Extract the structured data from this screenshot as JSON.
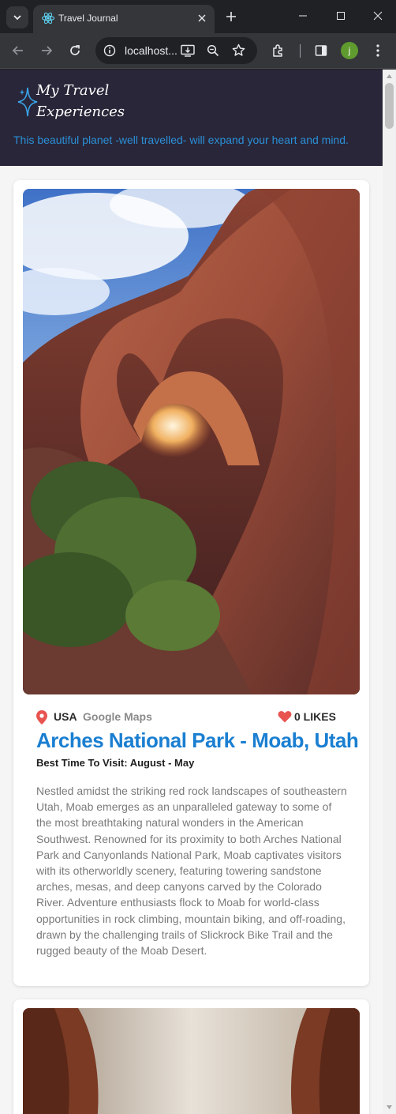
{
  "browser": {
    "tab_title": "Travel Journal",
    "url": "localhost...",
    "profile_initial": "j"
  },
  "header": {
    "logo_text": "My Travel\nExperiences",
    "tagline": "This beautiful planet -well travelled- will expand your heart and mind.",
    "background_color": "#292639",
    "tagline_color": "#2a8fd6"
  },
  "entries": [
    {
      "country": "USA",
      "maps_label": "Google Maps",
      "likes": "0 LIKES",
      "title": "Arches National Park - Moab, Utah",
      "best_time": "Best Time To Visit: August - May",
      "description": "Nestled amidst the striking red rock landscapes of southeastern Utah, Moab emerges as an unparalleled gateway to some of the most breathtaking natural wonders in the American Southwest. Renowned for its proximity to both Arches National Park and Canyonlands National Park, Moab captivates visitors with its otherworldly scenery, featuring towering sandstone arches, mesas, and deep canyons carved by the Colorado River. Adventure enthusiasts flock to Moab for world-class opportunities in rock climbing, mountain biking, and off-roading, drawn by the challenging trails of Slickrock Bike Trail and the rugged beauty of the Moab Desert."
    }
  ],
  "colors": {
    "title_blue": "#1a7fd1",
    "pin_red": "#e85450",
    "heart_red": "#e85450"
  },
  "icons": [
    "chevron-down-icon",
    "react-icon",
    "close-icon",
    "plus-icon",
    "minimize-icon",
    "maximize-icon",
    "back-icon",
    "forward-icon",
    "reload-icon",
    "info-icon",
    "install-icon",
    "zoom-icon",
    "star-icon",
    "extensions-icon",
    "sidebar-icon",
    "kebab-menu-icon",
    "location-pin-icon",
    "heart-icon",
    "sparkle-star-icon"
  ]
}
